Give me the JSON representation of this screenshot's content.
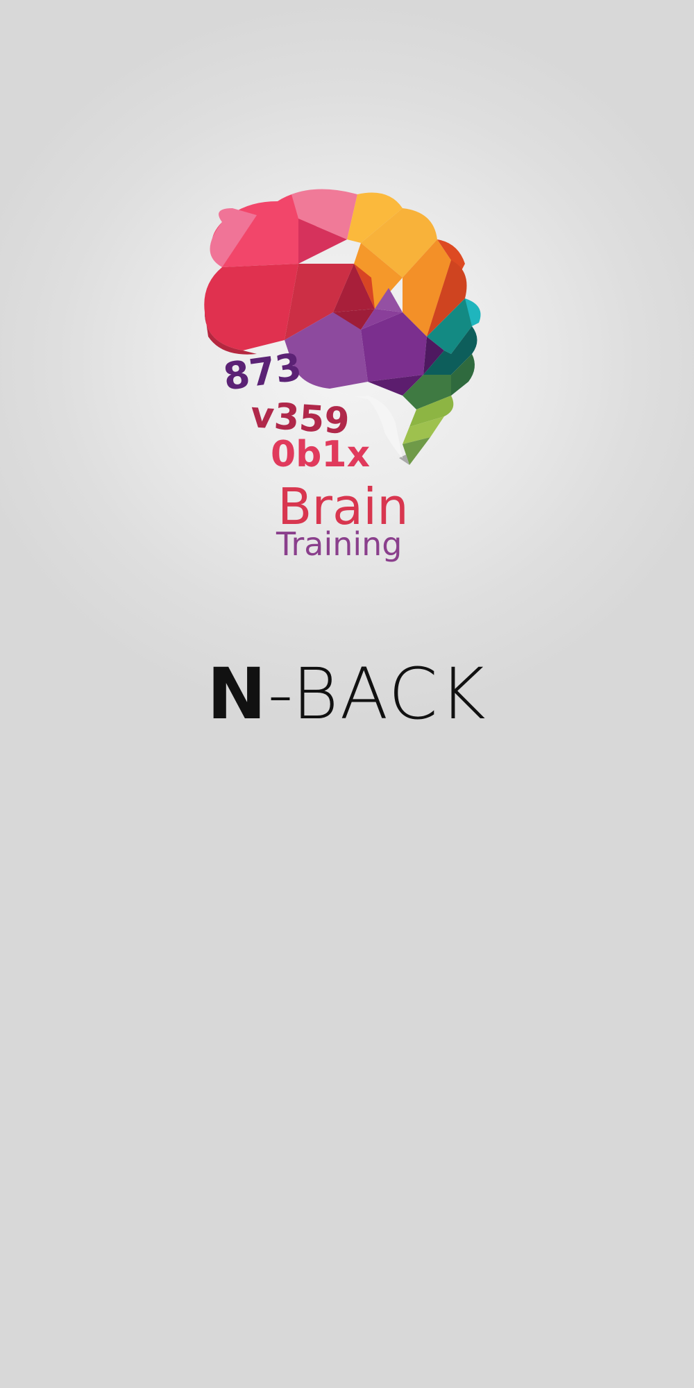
{
  "splash": {
    "logo": {
      "icon": "brain-icon",
      "digits_row1": "873",
      "digits_row2": "v359",
      "digits_row3": "0b1x",
      "wordmark_line1": "Brain",
      "wordmark_line2": "Training"
    },
    "app_title_bold": "N",
    "app_title_rest": "-BACK"
  },
  "colors": {
    "background": "#d8d8d8",
    "pink": "#f2466a",
    "crimson": "#d02f4a",
    "orange": "#f5982a",
    "yellow": "#fbb93c",
    "purple": "#7b2f8e",
    "teal": "#138a83",
    "green": "#8db543",
    "title": "#111111"
  }
}
